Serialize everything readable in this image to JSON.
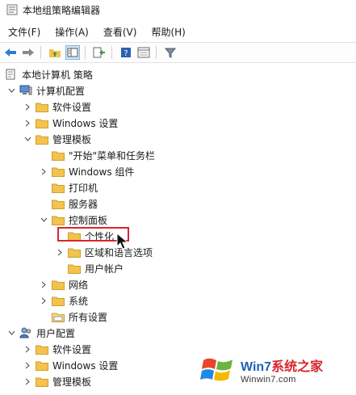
{
  "window": {
    "title": "本地组策略编辑器"
  },
  "menu": [
    {
      "label": "文件(F)"
    },
    {
      "label": "操作(A)"
    },
    {
      "label": "查看(V)"
    },
    {
      "label": "帮助(H)"
    }
  ],
  "toolbar": {
    "icons": [
      "back-arrow-icon",
      "forward-arrow-icon",
      "up-folder-icon",
      "show-tree-icon",
      "export-list-icon",
      "help-icon",
      "properties-icon",
      "filter-icon"
    ]
  },
  "tree": {
    "root": "本地计算机 策略",
    "computer_config": "计算机配置",
    "software_settings": "软件设置",
    "windows_settings": "Windows 设置",
    "admin_templates": "管理模板",
    "start_menu": "\"开始\"菜单和任务栏",
    "windows_components": "Windows 组件",
    "printers": "打印机",
    "server": "服务器",
    "control_panel": "控制面板",
    "personalization": "个性化",
    "region_language": "区域和语言选项",
    "user_accounts": "用户帐户",
    "network": "网络",
    "system": "系统",
    "all_settings": "所有设置",
    "user_config": "用户配置",
    "user_software_settings": "软件设置",
    "user_windows_settings": "Windows 设置",
    "user_admin_templates": "管理模板"
  },
  "watermark": {
    "brand_prefix": "Win7",
    "brand_suffix": "系统之家",
    "url": "Winwin7.com"
  },
  "colors": {
    "folder": "#f3c24f",
    "highlight_border": "#d9262c",
    "brand_blue": "#1e62b3"
  }
}
